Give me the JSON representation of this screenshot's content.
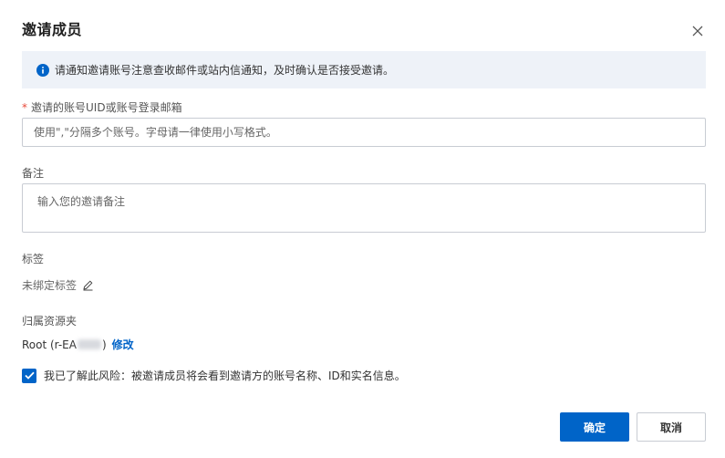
{
  "dialog": {
    "title": "邀请成员"
  },
  "notice": {
    "text": "请通知邀请账号注意查收邮件或站内信通知，及时确认是否接受邀请。"
  },
  "account_field": {
    "required_mark": "*",
    "label": "邀请的账号UID或账号登录邮箱",
    "placeholder": "使用\",\"分隔多个账号。字母请一律使用小写格式。",
    "value": ""
  },
  "remark_field": {
    "label": "备注",
    "placeholder": "输入您的邀请备注",
    "value": ""
  },
  "tags": {
    "label": "标签",
    "value": "未绑定标签"
  },
  "resource_folder": {
    "label": "归属资源夹",
    "value_prefix": "Root (r-EA",
    "value_suffix": ")",
    "modify_label": "修改"
  },
  "consent": {
    "checked": true,
    "text": "我已了解此风险：被邀请成员将会看到邀请方的账号名称、ID和实名信息。"
  },
  "footer": {
    "confirm_label": "确定",
    "cancel_label": "取消"
  },
  "colors": {
    "primary": "#0064c8",
    "notice_bg": "#eef2f8",
    "required": "#e84a3a"
  }
}
